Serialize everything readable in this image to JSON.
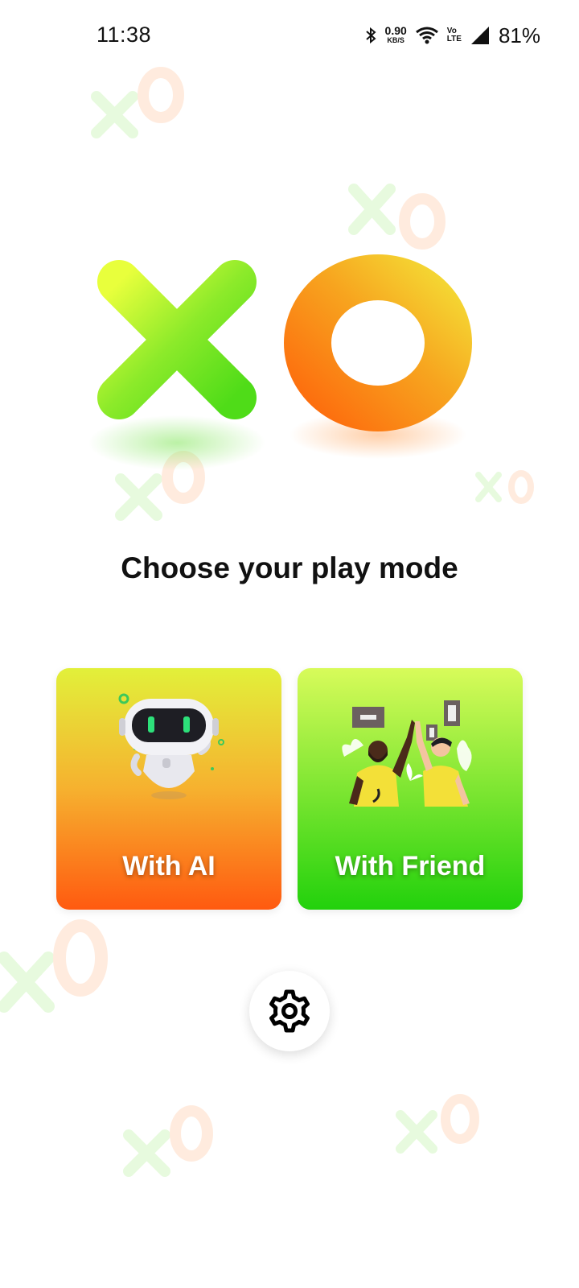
{
  "status_bar": {
    "time": "11:38",
    "net_speed_value": "0.90",
    "net_speed_unit": "KB/S",
    "volte_top": "Vo",
    "volte_bottom": "LTE",
    "battery": "81%"
  },
  "logo": {
    "x_letter": "X",
    "o_letter": "O"
  },
  "mode_title": "Choose your play mode",
  "modes": [
    {
      "label": "With AI",
      "icon": "robot-icon"
    },
    {
      "label": "With Friend",
      "icon": "high-five-illustration"
    }
  ],
  "settings": {
    "icon": "gear-icon"
  },
  "colors": {
    "x_gradient": [
      "#e8ff3c",
      "#5fe21e"
    ],
    "o_gradient": [
      "#ff5a08",
      "#f3ee3c"
    ],
    "ai_card": [
      "#e2f03a",
      "#ff5a10"
    ],
    "friend_card": [
      "#d8fb5a",
      "#22d10c"
    ]
  }
}
